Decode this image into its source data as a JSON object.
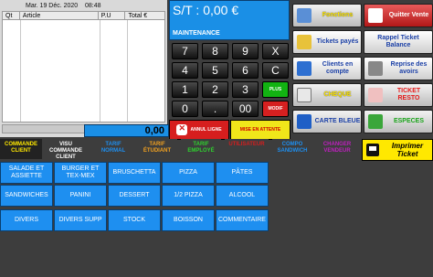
{
  "ticket": {
    "date": "Mar. 19 Déc. 2020",
    "time": "08:48",
    "columns": [
      "Qt",
      "Article",
      "P.U",
      "Total €"
    ],
    "total": "0,00"
  },
  "display": {
    "amount_line": "S/T : 0,00 €",
    "mode": "MAINTENANCE"
  },
  "keypad": {
    "keys": [
      "7",
      "8",
      "9",
      "X",
      "4",
      "5",
      "6",
      "C",
      "1",
      "2",
      "3",
      "0",
      ".",
      "00"
    ],
    "plus": "PLUS",
    "modif": "MODIF",
    "annul": "ANNUL LIGNE",
    "attente": "MISE EN ATTENTE"
  },
  "functions": {
    "fonctions": "Fonctions",
    "quitter": "Quitter Vente",
    "tickets_payes": "Tickets payés",
    "rappel_ticket": "Rappel Ticket Balance",
    "clients": "Clients en compte",
    "reprise": "Reprise des avoirs",
    "cheque": "CHEQUE",
    "ticket_resto": "TICKET RESTO",
    "carte_bleue": "CARTE BLEUE",
    "especes": "ESPECES"
  },
  "tariffs": {
    "commande_client": "COMMANDE CLIENT",
    "visu_commande": "VISU COMMANDE CLIENT",
    "tarif_normal": "TARIF NORMAL",
    "tarif_etudiant": "TARIF ÉTUDIANT",
    "tarif_employe": "TARIF EMPLOYÉ",
    "utilisateur": "UTILISATEUR",
    "compo_sandwich": "COMPO SANDWICH",
    "changer_vendeur": "CHANGER VENDEUR",
    "imprimer": "Imprimer Ticket"
  },
  "products": {
    "row1": [
      "SALADE ET ASSIETTE",
      "BURGER ET TEX-MEX",
      "BRUSCHETTA",
      "PIZZA",
      "PÂTES"
    ],
    "row2": [
      "SANDWICHES",
      "PANINI",
      "DESSERT",
      "1/2 PIZZA",
      "ALCOOL"
    ],
    "row3": [
      "DIVERS",
      "DIVERS SUPP",
      "STOCK",
      "BOISSON",
      "COMMENTAIRE"
    ]
  },
  "colors": {
    "accent_blue": "#1e8ff0",
    "yellow": "#ffe800",
    "red": "#d61e1e",
    "green": "#12b312"
  }
}
